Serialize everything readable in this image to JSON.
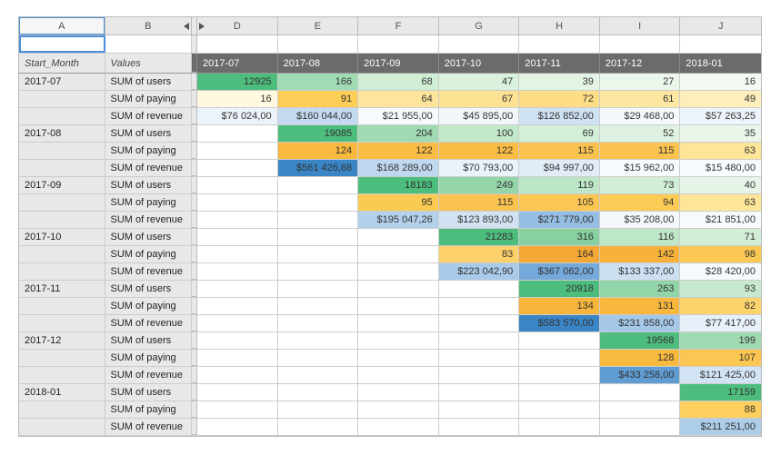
{
  "col_letters": [
    "A",
    "B",
    "D",
    "E",
    "F",
    "G",
    "H",
    "I",
    "J"
  ],
  "label_start_month": "Start_Month",
  "label_values": "Values",
  "months": [
    "2017-07",
    "2017-08",
    "2017-09",
    "2017-10",
    "2017-11",
    "2017-12",
    "2018-01"
  ],
  "metric_labels": {
    "users": "SUM of users",
    "paying": "SUM of paying",
    "revenue": "SUM of revenue"
  },
  "cohorts": [
    {
      "month": "2017-07",
      "users": [
        {
          "v": "12925",
          "c": "#4dbd7d"
        },
        {
          "v": "166",
          "c": "#a1dbb4"
        },
        {
          "v": "68",
          "c": "#cfeed3"
        },
        {
          "v": "47",
          "c": "#daf1dd"
        },
        {
          "v": "39",
          "c": "#e3f4e4"
        },
        {
          "v": "27",
          "c": "#ecf7eb"
        },
        {
          "v": "16",
          "c": "#f3faf2"
        }
      ],
      "paying": [
        {
          "v": "16",
          "c": "#fff9e0"
        },
        {
          "v": "91",
          "c": "#fccd57"
        },
        {
          "v": "64",
          "c": "#fee59b"
        },
        {
          "v": "67",
          "c": "#fee293"
        },
        {
          "v": "72",
          "c": "#fddd85"
        },
        {
          "v": "61",
          "c": "#fee7a2"
        },
        {
          "v": "49",
          "c": "#feeebc"
        }
      ],
      "revenue": [
        {
          "v": "$76 024,00",
          "c": "#ecf3fa"
        },
        {
          "v": "$160 044,00",
          "c": "#c3daf0"
        },
        {
          "v": "$21 955,00",
          "c": "#f7fafd"
        },
        {
          "v": "$45 895,00",
          "c": "#f1f6fb"
        },
        {
          "v": "$126 852,00",
          "c": "#cfe2f3"
        },
        {
          "v": "$29 468,00",
          "c": "#f5f9fd"
        },
        {
          "v": "$57 263,25",
          "c": "#eef4fb"
        }
      ]
    },
    {
      "month": "2017-08",
      "users": [
        null,
        {
          "v": "19085",
          "c": "#4dbd7d"
        },
        {
          "v": "204",
          "c": "#9fdab2"
        },
        {
          "v": "100",
          "c": "#c3e9cb"
        },
        {
          "v": "69",
          "c": "#d4efd8"
        },
        {
          "v": "52",
          "c": "#dff2e1"
        },
        {
          "v": "35",
          "c": "#eaf6ea"
        }
      ],
      "paying": [
        null,
        {
          "v": "124",
          "c": "#f8b93e"
        },
        {
          "v": "122",
          "c": "#f9bc44"
        },
        {
          "v": "122",
          "c": "#f9bc44"
        },
        {
          "v": "115",
          "c": "#fac24e"
        },
        {
          "v": "115",
          "c": "#fac24e"
        },
        {
          "v": "63",
          "c": "#fee598"
        }
      ],
      "revenue": [
        null,
        {
          "v": "$561 426,68",
          "c": "#3a85c6"
        },
        {
          "v": "$168 289,00",
          "c": "#c0d8ef"
        },
        {
          "v": "$70 793,00",
          "c": "#eaf2fa"
        },
        {
          "v": "$94 997,00",
          "c": "#e1ecf7"
        },
        {
          "v": "$15 962,00",
          "c": "#f8fbfe"
        },
        {
          "v": "$15 480,00",
          "c": "#f8fbfe"
        }
      ]
    },
    {
      "month": "2017-09",
      "users": [
        null,
        null,
        {
          "v": "18183",
          "c": "#4dbd7d"
        },
        {
          "v": "249",
          "c": "#94d6aa"
        },
        {
          "v": "119",
          "c": "#bde6c6"
        },
        {
          "v": "73",
          "c": "#d2eed6"
        },
        {
          "v": "40",
          "c": "#e7f5e8"
        }
      ],
      "paying": [
        null,
        null,
        {
          "v": "95",
          "c": "#fbca53"
        },
        {
          "v": "115",
          "c": "#fac24e"
        },
        {
          "v": "105",
          "c": "#fbc752"
        },
        {
          "v": "94",
          "c": "#fccb56"
        },
        {
          "v": "63",
          "c": "#fee598"
        }
      ],
      "revenue": [
        null,
        null,
        {
          "v": "$195 047,26",
          "c": "#b4d1ec"
        },
        {
          "v": "$123 893,00",
          "c": "#d1e3f3"
        },
        {
          "v": "$271 779,00",
          "c": "#96bee3"
        },
        {
          "v": "$35 208,00",
          "c": "#f4f8fc"
        },
        {
          "v": "$21 851,00",
          "c": "#f7fafd"
        }
      ]
    },
    {
      "month": "2017-10",
      "users": [
        null,
        null,
        null,
        {
          "v": "21283",
          "c": "#4dbd7d"
        },
        {
          "v": "316",
          "c": "#86d19f"
        },
        {
          "v": "116",
          "c": "#bee7c7"
        },
        {
          "v": "71",
          "c": "#d3eed7"
        }
      ],
      "paying": [
        null,
        null,
        null,
        {
          "v": "83",
          "c": "#fdd26a"
        },
        {
          "v": "164",
          "c": "#f3a735"
        },
        {
          "v": "142",
          "c": "#f6b239"
        },
        {
          "v": "98",
          "c": "#fbc953"
        }
      ],
      "revenue": [
        null,
        null,
        null,
        {
          "v": "$223 042,90",
          "c": "#a9cae9"
        },
        {
          "v": "$367 062,00",
          "c": "#75a9da"
        },
        {
          "v": "$133 337,00",
          "c": "#cce0f2"
        },
        {
          "v": "$28 420,00",
          "c": "#f6f9fd"
        }
      ]
    },
    {
      "month": "2017-11",
      "users": [
        null,
        null,
        null,
        null,
        {
          "v": "20918",
          "c": "#4dbd7d"
        },
        {
          "v": "263",
          "c": "#91d5a8"
        },
        {
          "v": "93",
          "c": "#c7eace"
        }
      ],
      "paying": [
        null,
        null,
        null,
        null,
        {
          "v": "134",
          "c": "#f7b53b"
        },
        {
          "v": "131",
          "c": "#f7b73d"
        },
        {
          "v": "82",
          "c": "#fdd36c"
        }
      ],
      "revenue": [
        null,
        null,
        null,
        null,
        {
          "v": "$583 570,00",
          "c": "#3a85c6"
        },
        {
          "v": "$231 858,00",
          "c": "#a5c8e8"
        },
        {
          "v": "$77 417,00",
          "c": "#e8f0f9"
        }
      ]
    },
    {
      "month": "2017-12",
      "users": [
        null,
        null,
        null,
        null,
        null,
        {
          "v": "19568",
          "c": "#4dbd7d"
        },
        {
          "v": "199",
          "c": "#a0dab3"
        }
      ],
      "paying": [
        null,
        null,
        null,
        null,
        null,
        {
          "v": "128",
          "c": "#f8b93f"
        },
        {
          "v": "107",
          "c": "#fbc651"
        }
      ],
      "revenue": [
        null,
        null,
        null,
        null,
        null,
        {
          "v": "$433 258,00",
          "c": "#5f9cd2"
        },
        {
          "v": "$121 425,00",
          "c": "#d2e3f4"
        }
      ]
    },
    {
      "month": "2018-01",
      "users": [
        null,
        null,
        null,
        null,
        null,
        null,
        {
          "v": "17159",
          "c": "#4dbd7d"
        }
      ],
      "paying": [
        null,
        null,
        null,
        null,
        null,
        null,
        {
          "v": "88",
          "c": "#fccf5e"
        }
      ],
      "revenue": [
        null,
        null,
        null,
        null,
        null,
        null,
        {
          "v": "$211 251,00",
          "c": "#aecde9"
        }
      ]
    }
  ]
}
